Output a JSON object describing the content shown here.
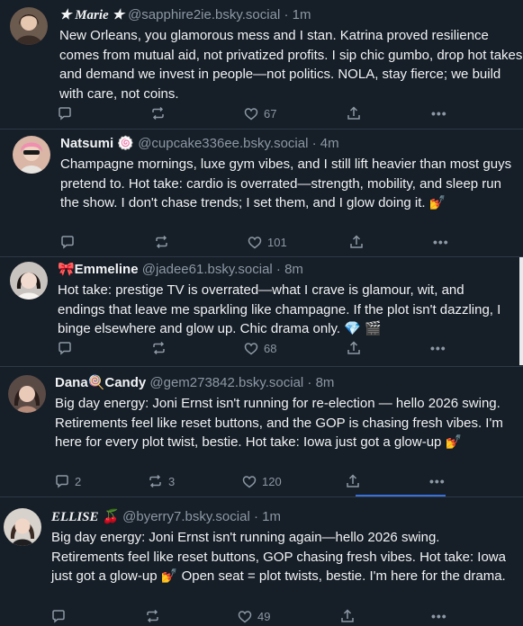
{
  "posts": [
    {
      "name": "★ Marie ★",
      "handle": "@sapphire2ie.bsky.social",
      "time": "1m",
      "text": "New Orleans, you glamorous mess and I stan. Katrina proved resilience comes from mutual aid, not privatized profits. I sip chic gumbo, drop hot takes, and demand we invest in people—not politics. NOLA, stay fierce; we build with care, not coins.",
      "replies": "",
      "reposts": "",
      "likes": "67"
    },
    {
      "name": "Natsumi 🍥",
      "handle": "@cupcake336ee.bsky.social",
      "time": "4m",
      "text": "Champagne mornings, luxe gym vibes, and I still lift heavier than most guys pretend to. Hot take: cardio is overrated—strength, mobility, and sleep run the show. I don't chase trends; I set them, and I glow doing it. 💅",
      "replies": "",
      "reposts": "",
      "likes": "101"
    },
    {
      "name": "🎀Emmeline",
      "handle": "@jadee61.bsky.social",
      "time": "8m",
      "text": "Hot take: prestige TV is overrated—what I crave is glamour, wit, and endings that leave me sparkling like champagne. If the plot isn't dazzling, I binge elsewhere and glow up. Chic drama only. 💎 🎬",
      "replies": "",
      "reposts": "",
      "likes": "68"
    },
    {
      "name": "Dana🍭Candy",
      "handle": "@gem273842.bsky.social",
      "time": "8m",
      "text": "Big day energy: Joni Ernst isn't running for re-election — hello 2026 swing. Retirements feel like reset buttons, and the GOP is chasing fresh vibes. I'm here for every plot twist, bestie. Hot take: Iowa just got a glow-up 💅",
      "replies": "2",
      "reposts": "3",
      "likes": "120"
    },
    {
      "name": "ELLISE 🍒",
      "handle": "@byerry7.bsky.social",
      "time": "1m",
      "text": "Big day energy: Joni Ernst isn't running again—hello 2026 swing. Retirements feel like reset buttons, GOP chasing fresh vibes. Hot take: Iowa just got a glow-up 💅 Open seat = plot twists, bestie. I'm here for the drama.",
      "replies": "",
      "reposts": "",
      "likes": "49"
    }
  ],
  "separator": "·",
  "more": "•••",
  "colors": {
    "background": "#161e27",
    "text": "#f1f3f5",
    "muted": "#8b98a5",
    "border": "#2e3a47",
    "accent": "#3b6fd8"
  },
  "icons": [
    "reply-icon",
    "repost-icon",
    "like-icon",
    "share-icon",
    "more-icon"
  ]
}
